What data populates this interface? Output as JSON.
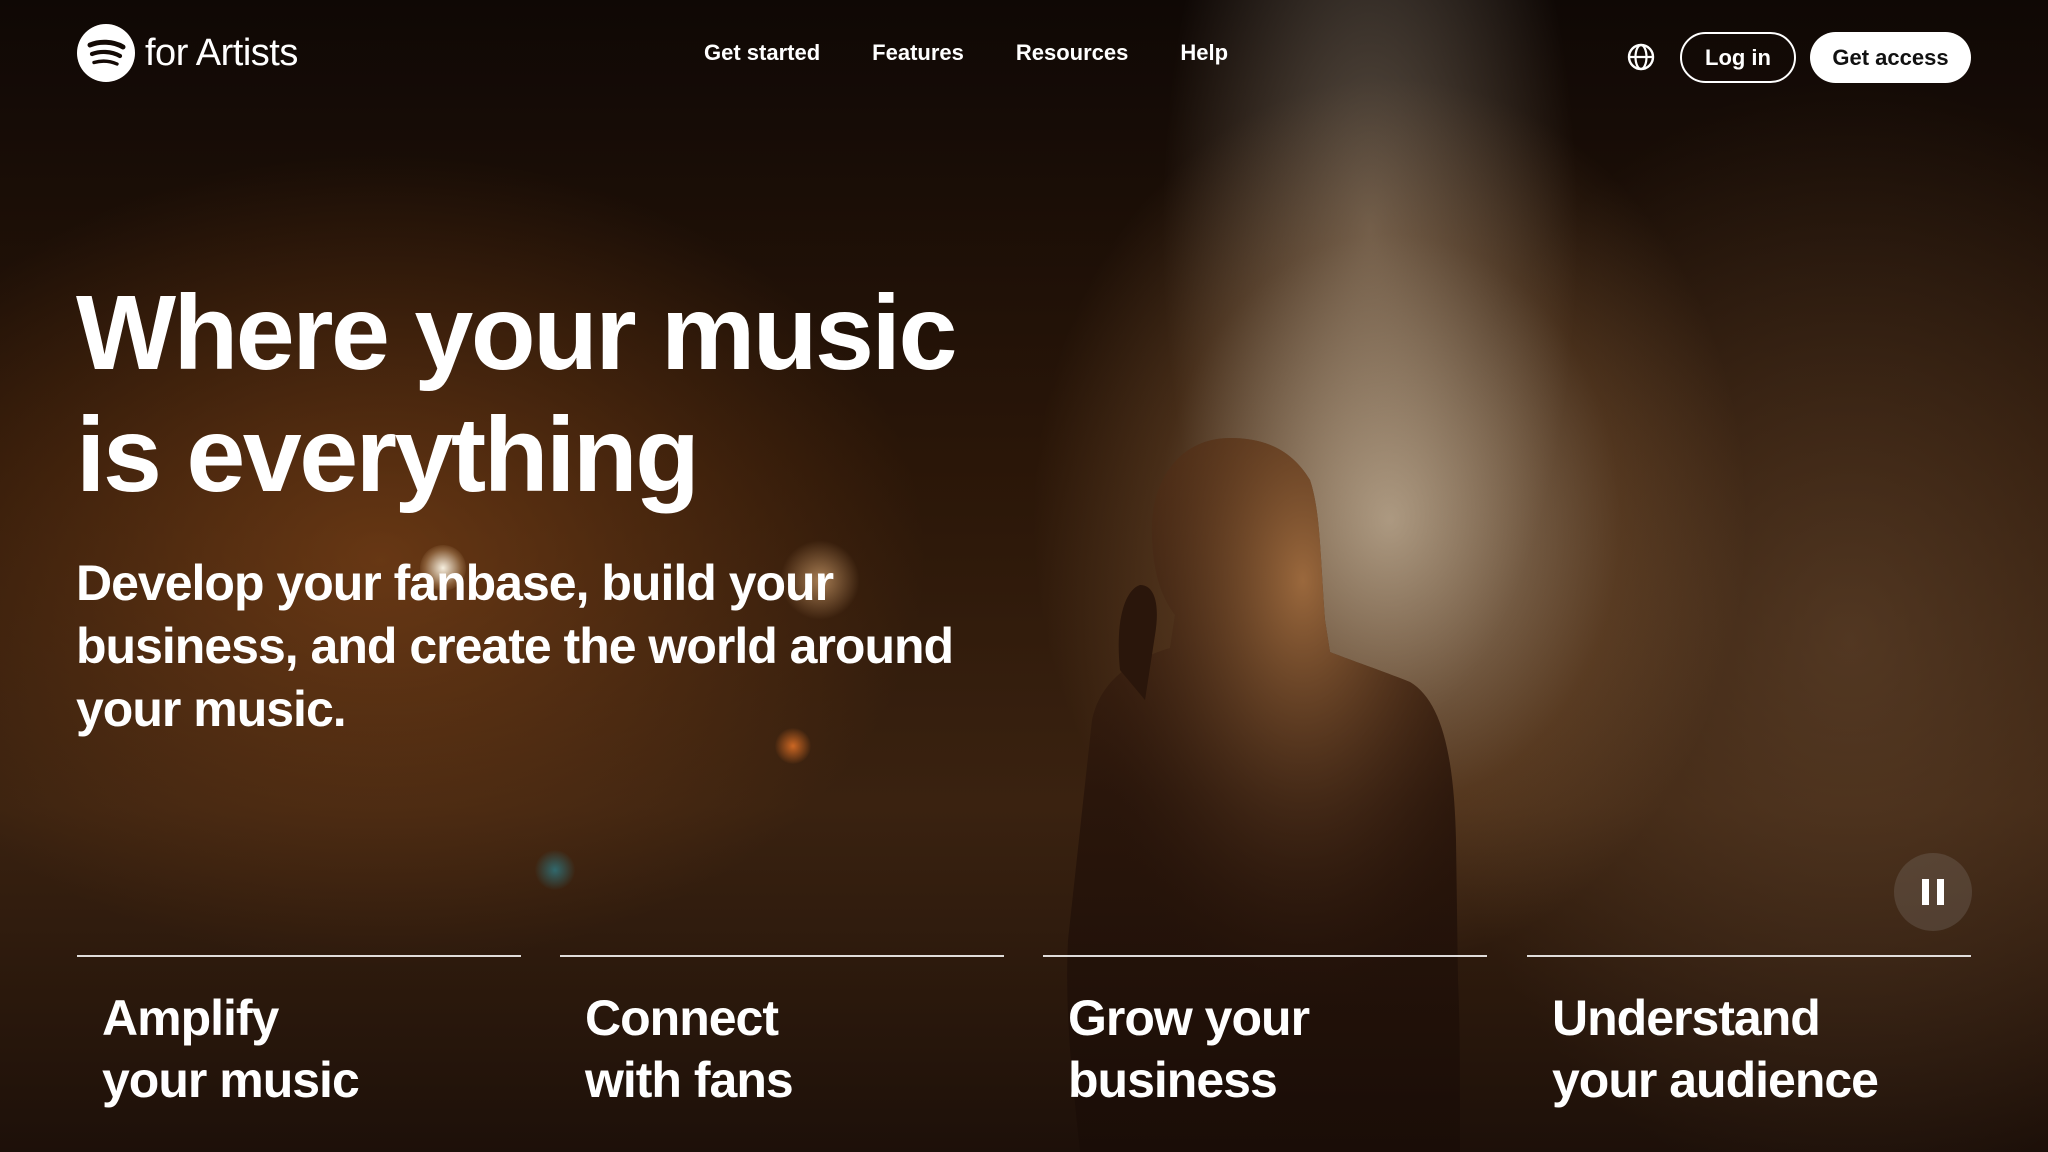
{
  "brand": {
    "logo_icon": "spotify-logo-icon",
    "text": "for Artists"
  },
  "nav": {
    "items": [
      {
        "label": "Get started"
      },
      {
        "label": "Features"
      },
      {
        "label": "Resources"
      },
      {
        "label": "Help"
      }
    ]
  },
  "header_actions": {
    "language_icon": "globe-icon",
    "login_label": "Log in",
    "get_access_label": "Get access"
  },
  "hero": {
    "title_lines": [
      "Where your music",
      "is everything"
    ],
    "subtitle_lines": [
      "Develop your fanbase, build your",
      "business, and create the world around",
      "your music."
    ],
    "media_control_icon": "pause-icon"
  },
  "feature_tabs": [
    {
      "lines": [
        "Amplify",
        "your music"
      ]
    },
    {
      "lines": [
        "Connect",
        "with fans"
      ]
    },
    {
      "lines": [
        "Grow your",
        "business"
      ]
    },
    {
      "lines": [
        "Understand",
        "your audience"
      ]
    }
  ],
  "colors": {
    "background": "#130b06",
    "text": "#ffffff",
    "primary_button_bg": "#ffffff",
    "primary_button_text": "#111111"
  }
}
